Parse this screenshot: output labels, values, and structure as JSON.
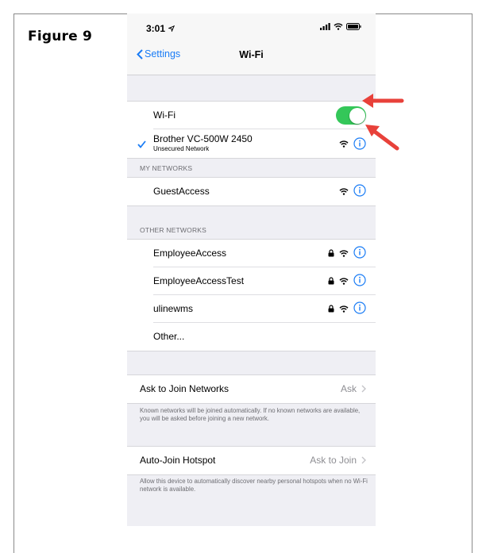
{
  "figure_label": "Figure 9",
  "status_bar": {
    "time": "3:01"
  },
  "nav": {
    "back_label": "Settings",
    "title": "Wi-Fi"
  },
  "wifi_toggle": {
    "label": "Wi-Fi",
    "on": true
  },
  "connected_network": {
    "name": "Brother VC-500W 2450",
    "subtitle": "Unsecured Network"
  },
  "my_networks": {
    "header": "MY NETWORKS",
    "items": [
      {
        "name": "GuestAccess"
      }
    ]
  },
  "other_networks": {
    "header": "OTHER NETWORKS",
    "items": [
      {
        "name": "EmployeeAccess",
        "locked": true
      },
      {
        "name": "EmployeeAccessTest",
        "locked": true
      },
      {
        "name": "ulinewms",
        "locked": true
      }
    ],
    "other_label": "Other..."
  },
  "ask_to_join": {
    "label": "Ask to Join Networks",
    "value": "Ask",
    "footnote": "Known networks will be joined automatically. If no known networks are available, you will be asked before joining a new network."
  },
  "auto_join": {
    "label": "Auto-Join Hotspot",
    "value": "Ask to Join",
    "footnote": "Allow this device to automatically discover nearby personal hotspots when no Wi-Fi network is available."
  },
  "colors": {
    "accent": "#1a7cf5",
    "toggle_on": "#34c759",
    "arrow": "#e8413a",
    "background": "#efeff4"
  }
}
